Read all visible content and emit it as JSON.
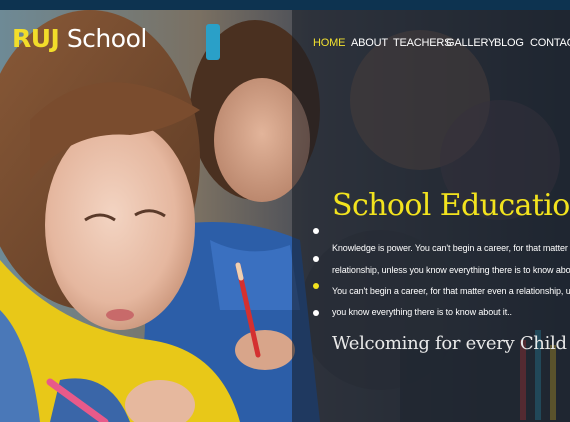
{
  "brand": {
    "logo_part1": "RUJ",
    "logo_part2": "School"
  },
  "nav": {
    "items": [
      {
        "label": "HOME",
        "active": true
      },
      {
        "label": "ABOUT",
        "active": false
      },
      {
        "label": "TEACHERS",
        "active": false
      },
      {
        "label": "GALLERY",
        "active": false
      },
      {
        "label": "BLOG",
        "active": false
      },
      {
        "label": "CONTACT",
        "active": false
      }
    ]
  },
  "hero": {
    "title": "School Education",
    "lines": [
      "Knowledge is power. You can't begin a career, for that matter even a",
      "relationship, unless you know everything there is to know about it",
      "You can't begin a career, for that matter even a relationship, unless",
      "you know everything there is to know about it.."
    ],
    "welcome": "Welcoming for every Child",
    "slide_count": 4,
    "active_slide_index": 2
  },
  "colors": {
    "accent": "#f2e31e",
    "topbar": "#0d3350",
    "text": "#ffffff"
  }
}
